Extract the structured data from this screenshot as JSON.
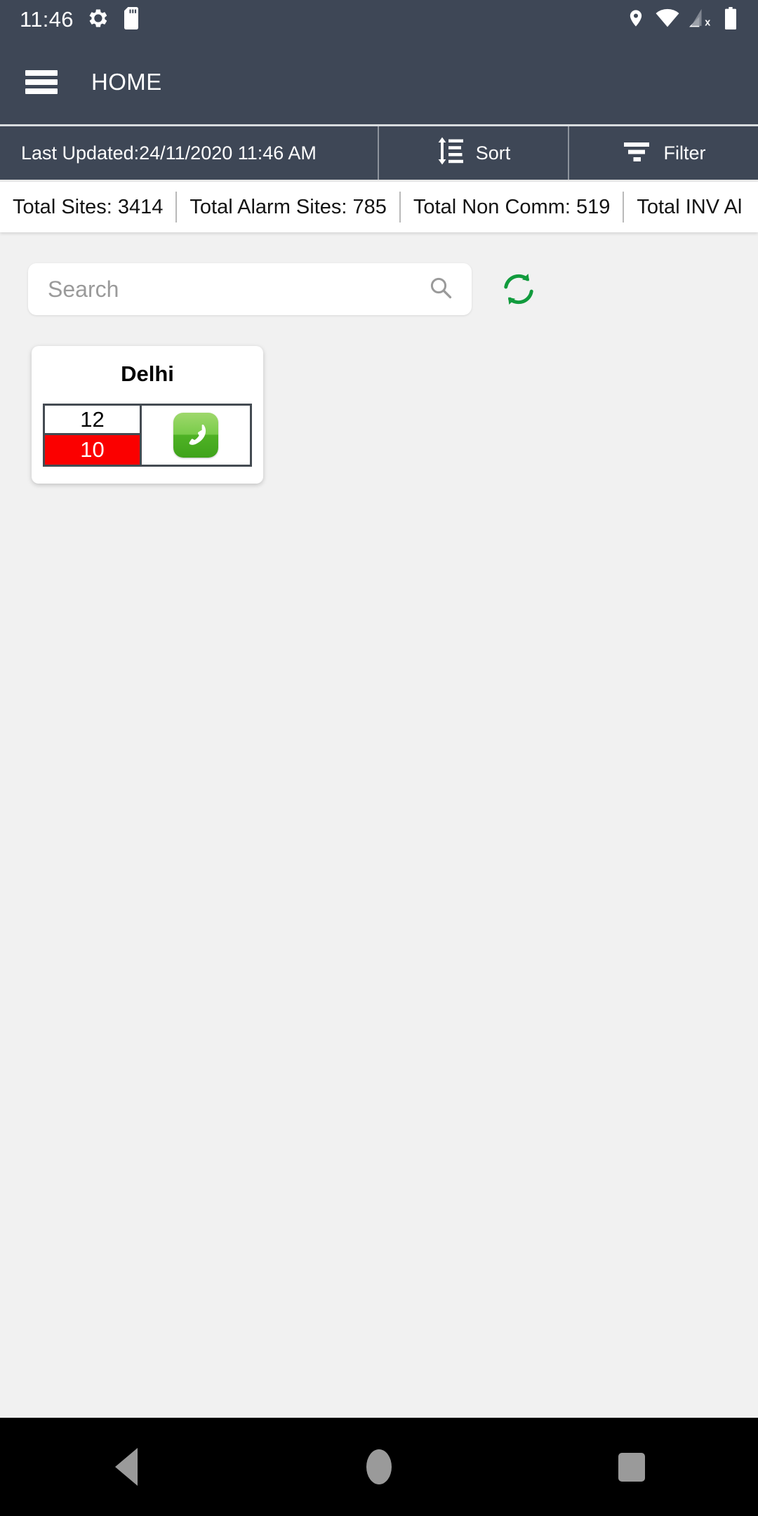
{
  "status_bar": {
    "time": "11:46",
    "left_icons": [
      "settings-gear-icon",
      "sd-card-icon"
    ],
    "right_icons": [
      "location-pin-icon",
      "wifi-icon",
      "cellular-signal-no-service-icon",
      "battery-full-icon"
    ],
    "background_color": "#3e4756"
  },
  "app_bar": {
    "menu_icon": "hamburger-menu-icon",
    "title": "HOME"
  },
  "sub_toolbar": {
    "last_updated": "Last Updated:24/11/2020 11:46 AM",
    "sort_label": "Sort",
    "sort_icon": "sort-icon",
    "filter_label": "Filter",
    "filter_icon": "filter-icon"
  },
  "stats": [
    {
      "label": "Total Sites: 3414"
    },
    {
      "label": "Total Alarm Sites: 785"
    },
    {
      "label": "Total Non Comm: 519"
    },
    {
      "label": "Total INV Al"
    }
  ],
  "search": {
    "value": "",
    "placeholder": "Search",
    "search_icon": "search-icon",
    "refresh_icon": "refresh-sync-icon",
    "refresh_color": "#119b3d"
  },
  "cards": [
    {
      "title": "Delhi",
      "count_top": "12",
      "count_bottom": "10",
      "alert_color": "#fb0000",
      "action_icon": "phone-call-icon",
      "action_color": "#4fb225"
    }
  ],
  "nav_bar": {
    "back": "back-button",
    "home": "home-button",
    "recents": "recents-button"
  }
}
